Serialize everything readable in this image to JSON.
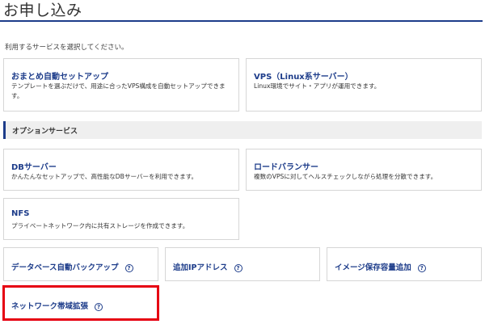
{
  "header": {
    "title": "お申し込み"
  },
  "intro": "利用するサービスを選択してください。",
  "services": [
    {
      "title": "おまとめ自動セットアップ",
      "description": "テンプレートを選ぶだけで、用途に合ったVPS構成を自動セットアップできます。"
    },
    {
      "title": "VPS（Linux系サーバー）",
      "description": "Linux環境でサイト・アプリが運用できます。"
    }
  ],
  "options_section": {
    "title": "オプションサービス"
  },
  "options": [
    {
      "title": "DBサーバー",
      "description": "かんたんなセットアップで、高性能なDBサーバーを利用できます。"
    },
    {
      "title": "ロードバランサー",
      "description": "複数のVPSに対してヘルスチェックしながら処理を分散できます。"
    },
    {
      "title": "NFS",
      "description": "プライベートネットワーク内に共有ストレージを作成できます。"
    }
  ],
  "addons": [
    {
      "title": "データベース自動バックアップ"
    },
    {
      "title": "追加IPアドレス"
    },
    {
      "title": "イメージ保存容量追加"
    },
    {
      "title": "ネットワーク帯域拡張"
    }
  ],
  "icons": {
    "help": "question-circle-icon"
  },
  "colors": {
    "accent": "#1d3c8a",
    "highlight": "#e60012"
  }
}
